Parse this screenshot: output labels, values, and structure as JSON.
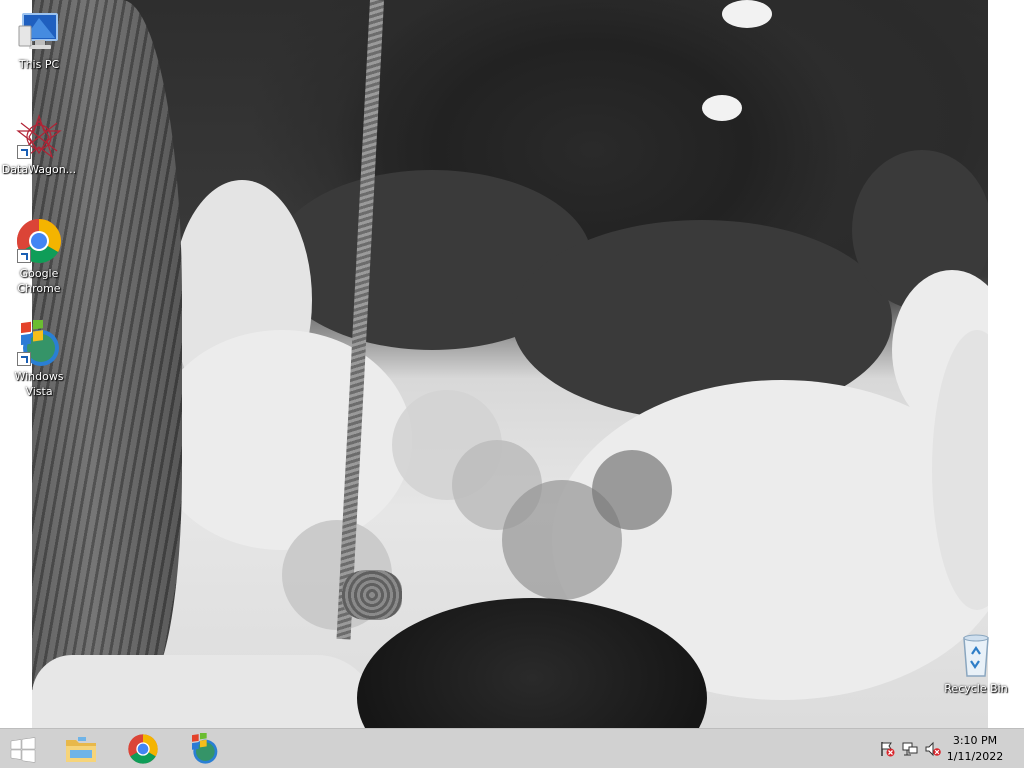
{
  "desktop": {
    "icons": [
      {
        "label": "This PC",
        "icon": "this-pc-icon"
      },
      {
        "label": "DataWagon...",
        "icon": "datawagon-icon"
      },
      {
        "label": "Google Chrome",
        "icon": "chrome-icon"
      },
      {
        "label": "Windows Vista",
        "icon": "windows-vista-icon"
      },
      {
        "label": "Recycle Bin",
        "icon": "recycle-bin-icon"
      }
    ]
  },
  "taskbar": {
    "pinned": [
      {
        "name": "start-button",
        "icon": "windows-logo-icon"
      },
      {
        "name": "file-explorer",
        "icon": "folder-icon"
      },
      {
        "name": "google-chrome",
        "icon": "chrome-icon"
      },
      {
        "name": "windows-vista",
        "icon": "windows-vista-icon"
      }
    ],
    "tray": {
      "icons": [
        "action-center-flag-icon",
        "network-icon",
        "volume-muted-icon"
      ],
      "time": "3:10 PM",
      "date": "1/11/2022"
    }
  },
  "colors": {
    "taskbar": "#cdcdcd",
    "desktop_bg": "#ffffff",
    "chrome_red": "#db4437",
    "chrome_green": "#0f9d58",
    "chrome_yellow": "#f4b400",
    "chrome_blue": "#4285f4"
  }
}
